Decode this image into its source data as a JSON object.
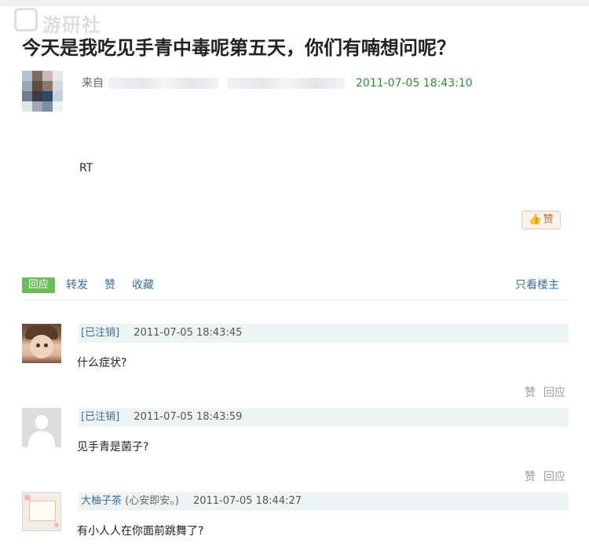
{
  "watermark": {
    "text": "游研社"
  },
  "post": {
    "title": "今天是我吃见手青中毒呢第五天，你们有喃想问呢？",
    "from_label": "来自",
    "time": "2011-07-05 18:43:10",
    "body": "RT",
    "like_label": "赞",
    "like_icon": "thumbs-up-icon"
  },
  "actions": {
    "reply": "回应",
    "forward": "转发",
    "like": "赞",
    "collect": "收藏",
    "only_op": "只看楼主"
  },
  "comments": [
    {
      "name": "[已注销]",
      "signature": "",
      "time": "2011-07-05 18:43:45",
      "text": "什么症状?",
      "like": "赞",
      "reply": "回应"
    },
    {
      "name": "[已注销]",
      "signature": "",
      "time": "2011-07-05 18:43:59",
      "text": "见手青是菌子?",
      "like": "赞",
      "reply": "回应"
    },
    {
      "name": "大柚子茶",
      "signature": "(心安即安。)",
      "time": "2011-07-05 18:44:27",
      "text": "有小人人在你面前跳舞了?",
      "like": "",
      "reply": ""
    }
  ],
  "colors": {
    "time_green": "#2e8b3a",
    "link_blue": "#3b6e9a",
    "reply_green": "#6bbd5b",
    "comment_header_bg": "#eef3f3"
  }
}
